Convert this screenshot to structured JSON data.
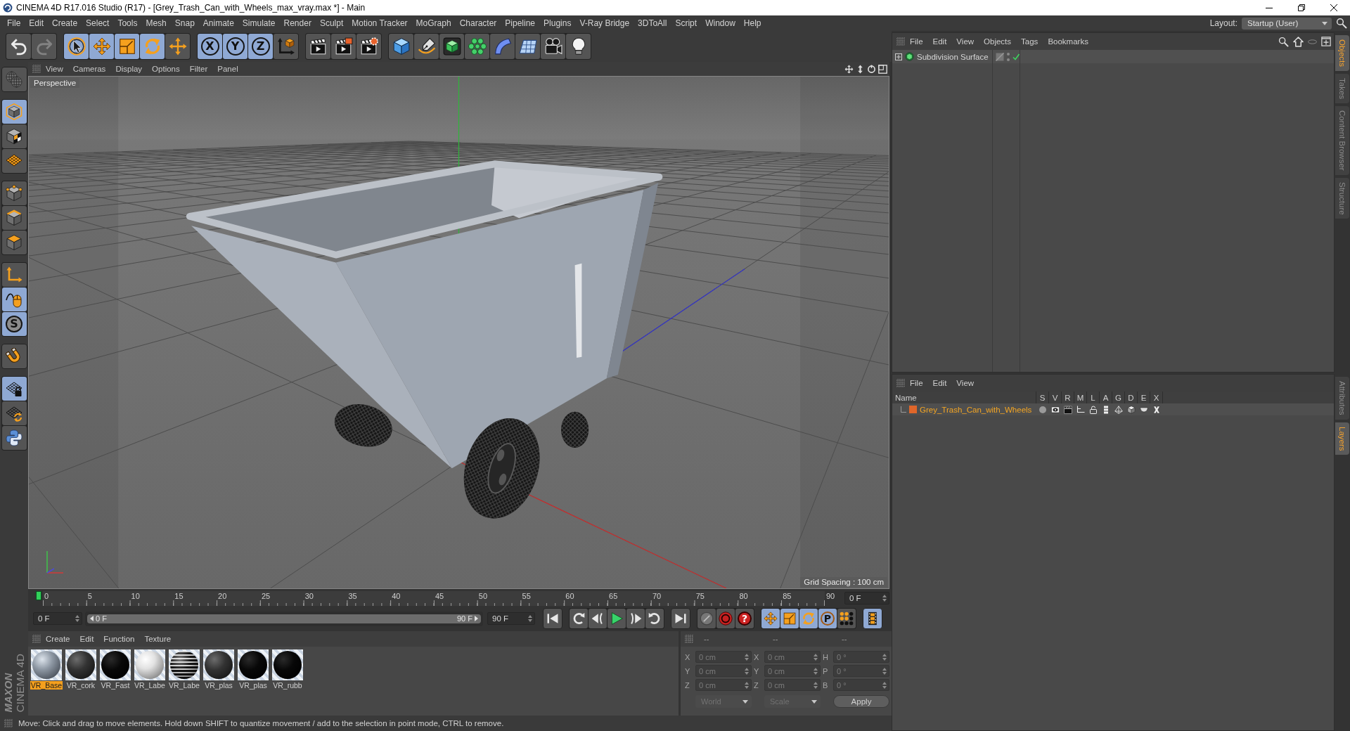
{
  "window": {
    "title": "CINEMA 4D R17.016 Studio (R17) - [Grey_Trash_Can_with_Wheels_max_vray.max *] - Main"
  },
  "menu_bar": {
    "items": [
      "File",
      "Edit",
      "Create",
      "Select",
      "Tools",
      "Mesh",
      "Snap",
      "Animate",
      "Simulate",
      "Render",
      "Sculpt",
      "Motion Tracker",
      "MoGraph",
      "Character",
      "Pipeline",
      "Plugins",
      "V-Ray Bridge",
      "3DToAll",
      "Script",
      "Window",
      "Help"
    ],
    "layout_label": "Layout:",
    "layout_value": "Startup (User)"
  },
  "toolbar": {
    "groups": [
      [
        {
          "kind": "undo",
          "active": false,
          "disabled": false
        },
        {
          "kind": "redo",
          "active": false,
          "disabled": true
        }
      ],
      [
        {
          "kind": "select",
          "active": true,
          "disabled": false
        },
        {
          "kind": "move",
          "active": true,
          "disabled": false
        },
        {
          "kind": "scale",
          "active": true,
          "disabled": false
        },
        {
          "kind": "rotate",
          "active": true,
          "disabled": false
        },
        {
          "kind": "recent",
          "active": false,
          "disabled": false
        }
      ],
      [
        {
          "kind": "axis",
          "label": "X",
          "active": true,
          "disabled": false
        },
        {
          "kind": "axis",
          "label": "Y",
          "active": true,
          "disabled": false
        },
        {
          "kind": "axis",
          "label": "Z",
          "active": true,
          "disabled": false
        },
        {
          "kind": "coords",
          "active": false,
          "disabled": false
        }
      ],
      [
        {
          "kind": "render_view",
          "active": false,
          "disabled": false
        },
        {
          "kind": "render",
          "active": false,
          "disabled": false
        },
        {
          "kind": "render_settings",
          "active": false,
          "disabled": false
        }
      ],
      [
        {
          "kind": "cube",
          "active": false,
          "disabled": false
        },
        {
          "kind": "pen",
          "active": false,
          "disabled": false
        },
        {
          "kind": "subdivision",
          "active": false,
          "disabled": false
        },
        {
          "kind": "cloner",
          "active": false,
          "disabled": false
        },
        {
          "kind": "bend",
          "active": false,
          "disabled": false
        },
        {
          "kind": "floor",
          "active": false,
          "disabled": false
        },
        {
          "kind": "camera",
          "active": false,
          "disabled": false
        },
        {
          "kind": "light",
          "active": false,
          "disabled": false
        }
      ]
    ]
  },
  "left_toolbar": {
    "groups": [
      [
        {
          "kind": "make_editable",
          "active": false
        }
      ],
      [
        {
          "kind": "model",
          "active": true
        },
        {
          "kind": "texture",
          "active": false
        },
        {
          "kind": "workplane",
          "active": false
        }
      ],
      [
        {
          "kind": "points",
          "active": false
        },
        {
          "kind": "edges",
          "active": false
        },
        {
          "kind": "polygons",
          "active": false
        }
      ],
      [
        {
          "kind": "axis",
          "active": false
        },
        {
          "kind": "tweak",
          "active": true
        },
        {
          "kind": "solo",
          "label": "S",
          "active": true
        }
      ],
      [
        {
          "kind": "magnet",
          "active": false
        }
      ],
      [
        {
          "kind": "lock_workplane",
          "active": true
        },
        {
          "kind": "grid_sync",
          "active": false
        },
        {
          "kind": "python",
          "active": false
        }
      ]
    ]
  },
  "viewport": {
    "menu": [
      "View",
      "Cameras",
      "Display",
      "Options",
      "Filter",
      "Panel"
    ],
    "camera": "Perspective",
    "grid_spacing": "Grid Spacing : 100 cm"
  },
  "timeline": {
    "ticks": [
      "0",
      "5",
      "10",
      "15",
      "20",
      "25",
      "30",
      "35",
      "40",
      "45",
      "50",
      "55",
      "60",
      "65",
      "70",
      "75",
      "80",
      "85",
      "90"
    ],
    "level": 0,
    "current_frame": "0 F"
  },
  "transport": {
    "start": "0 F",
    "range_start": "0 F",
    "range_end": "90 F",
    "level": 1,
    "end": "90 F",
    "groups": [
      [
        {
          "kind": "go_start",
          "active": false
        }
      ],
      [
        {
          "kind": "prev_key",
          "active": false
        },
        {
          "kind": "step_back",
          "active": false
        },
        {
          "kind": "play",
          "active": false
        },
        {
          "kind": "step_forward",
          "active": false
        },
        {
          "kind": "next_key",
          "active": false
        }
      ],
      [
        {
          "kind": "go_end",
          "active": false
        }
      ],
      [
        {
          "kind": "autokey",
          "active": false
        },
        {
          "kind": "record",
          "active": false
        },
        {
          "kind": "key_selection",
          "label": "?",
          "active": false
        }
      ],
      [
        {
          "kind": "key_move",
          "active": true
        },
        {
          "kind": "key_scale",
          "active": true
        },
        {
          "kind": "key_rotate",
          "active": true
        },
        {
          "kind": "key_param",
          "label": "P",
          "active": true
        },
        {
          "kind": "key_points",
          "active": false
        }
      ],
      [
        {
          "kind": "timeline",
          "active": true
        }
      ]
    ]
  },
  "materials": {
    "menu": [
      "Create",
      "Edit",
      "Function",
      "Texture"
    ],
    "items": [
      {
        "name": "VR_Base",
        "kind": "grey",
        "selected": true
      },
      {
        "name": "VR_cork",
        "kind": "dark",
        "selected": false
      },
      {
        "name": "VR_Fast",
        "kind": "black",
        "selected": false
      },
      {
        "name": "VR_Labe",
        "kind": "white",
        "selected": false
      },
      {
        "name": "VR_Labe",
        "kind": "label",
        "selected": false
      },
      {
        "name": "VR_plas",
        "kind": "dark",
        "selected": false
      },
      {
        "name": "VR_plas",
        "kind": "black",
        "selected": false
      },
      {
        "name": "VR_rubb",
        "kind": "black",
        "selected": false
      }
    ]
  },
  "coordinates": {
    "headers": [
      "--",
      "--",
      "--"
    ],
    "rows": [
      {
        "axis": "X",
        "position": "0 cm",
        "size_axis": "X",
        "size": "0 cm",
        "rotation_axis": "H",
        "rotation": "0 °"
      },
      {
        "axis": "Y",
        "position": "0 cm",
        "size_axis": "Y",
        "size": "0 cm",
        "rotation_axis": "P",
        "rotation": "0 °"
      },
      {
        "axis": "Z",
        "position": "0 cm",
        "size_axis": "Z",
        "size": "0 cm",
        "rotation_axis": "B",
        "rotation": "0 °"
      }
    ],
    "position_mode": "World",
    "size_mode": "Scale",
    "apply": "Apply"
  },
  "logo": {
    "brand": "MAXON",
    "product": "CINEMA 4D"
  },
  "status_bar": {
    "text": "Move: Click and drag to move elements. Hold down SHIFT to quantize movement / add to the selection in point mode, CTRL to remove."
  },
  "objects": {
    "menu": [
      "File",
      "Edit",
      "View",
      "Objects",
      "Tags",
      "Bookmarks"
    ],
    "rows": [
      {
        "name": "Subdivision Surface",
        "expanded": false,
        "enabled": true
      }
    ]
  },
  "layers": {
    "menu": [
      "File",
      "Edit",
      "View"
    ],
    "columns": [
      "Name",
      "S",
      "V",
      "R",
      "M",
      "L",
      "A",
      "G",
      "D",
      "E",
      "X"
    ],
    "rows": [
      {
        "name": "Grey_Trash_Can_with_Wheels",
        "color": "#e0662a",
        "selected": true
      }
    ]
  },
  "side_tabs": {
    "upper": [
      {
        "label": "Objects",
        "selected": true
      },
      {
        "label": "Takes",
        "selected": false
      },
      {
        "label": "Content Browser",
        "selected": false
      },
      {
        "label": "Structure",
        "selected": false
      }
    ],
    "lower": [
      {
        "label": "Attributes",
        "selected": false
      },
      {
        "label": "Layers",
        "selected": true
      }
    ]
  }
}
